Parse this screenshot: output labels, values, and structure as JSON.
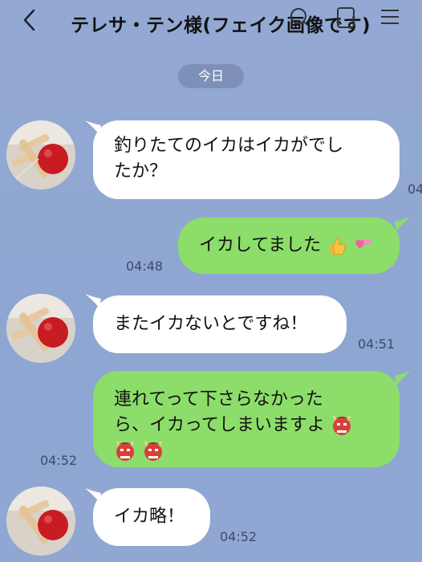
{
  "header": {
    "title": "テレサ・テン様(フェイク画像です)",
    "back_icon": "chevron-left-icon",
    "icons": [
      "search-icon",
      "phone-icon",
      "menu-icon"
    ]
  },
  "date_label": "今日",
  "messages": [
    {
      "side": "left",
      "text": "釣りたてのイカはイカがでしたか？",
      "line1": "釣りたてのイカはイカがでし",
      "line2": "たか？",
      "time": "04"
    },
    {
      "side": "right",
      "text": "イカしてました",
      "emojis": [
        "thumbs-up",
        "two-hearts"
      ],
      "time": "04:48"
    },
    {
      "side": "left",
      "text": "またイカないとですね！",
      "time": "04:51"
    },
    {
      "side": "right",
      "line1": "連れてって下さらなかった",
      "line2": "ら、イカってしまいますよ",
      "emojis": [
        "oni-mask",
        "oni-mask",
        "oni-mask"
      ],
      "time": "04:52"
    },
    {
      "side": "left",
      "text": "イカ略！",
      "time": "04:52"
    }
  ],
  "colors": {
    "background": "#8fa7d2",
    "incoming_bubble": "#ffffff",
    "outgoing_bubble": "#8ddd6a",
    "date_pill": "#7e90b8"
  }
}
